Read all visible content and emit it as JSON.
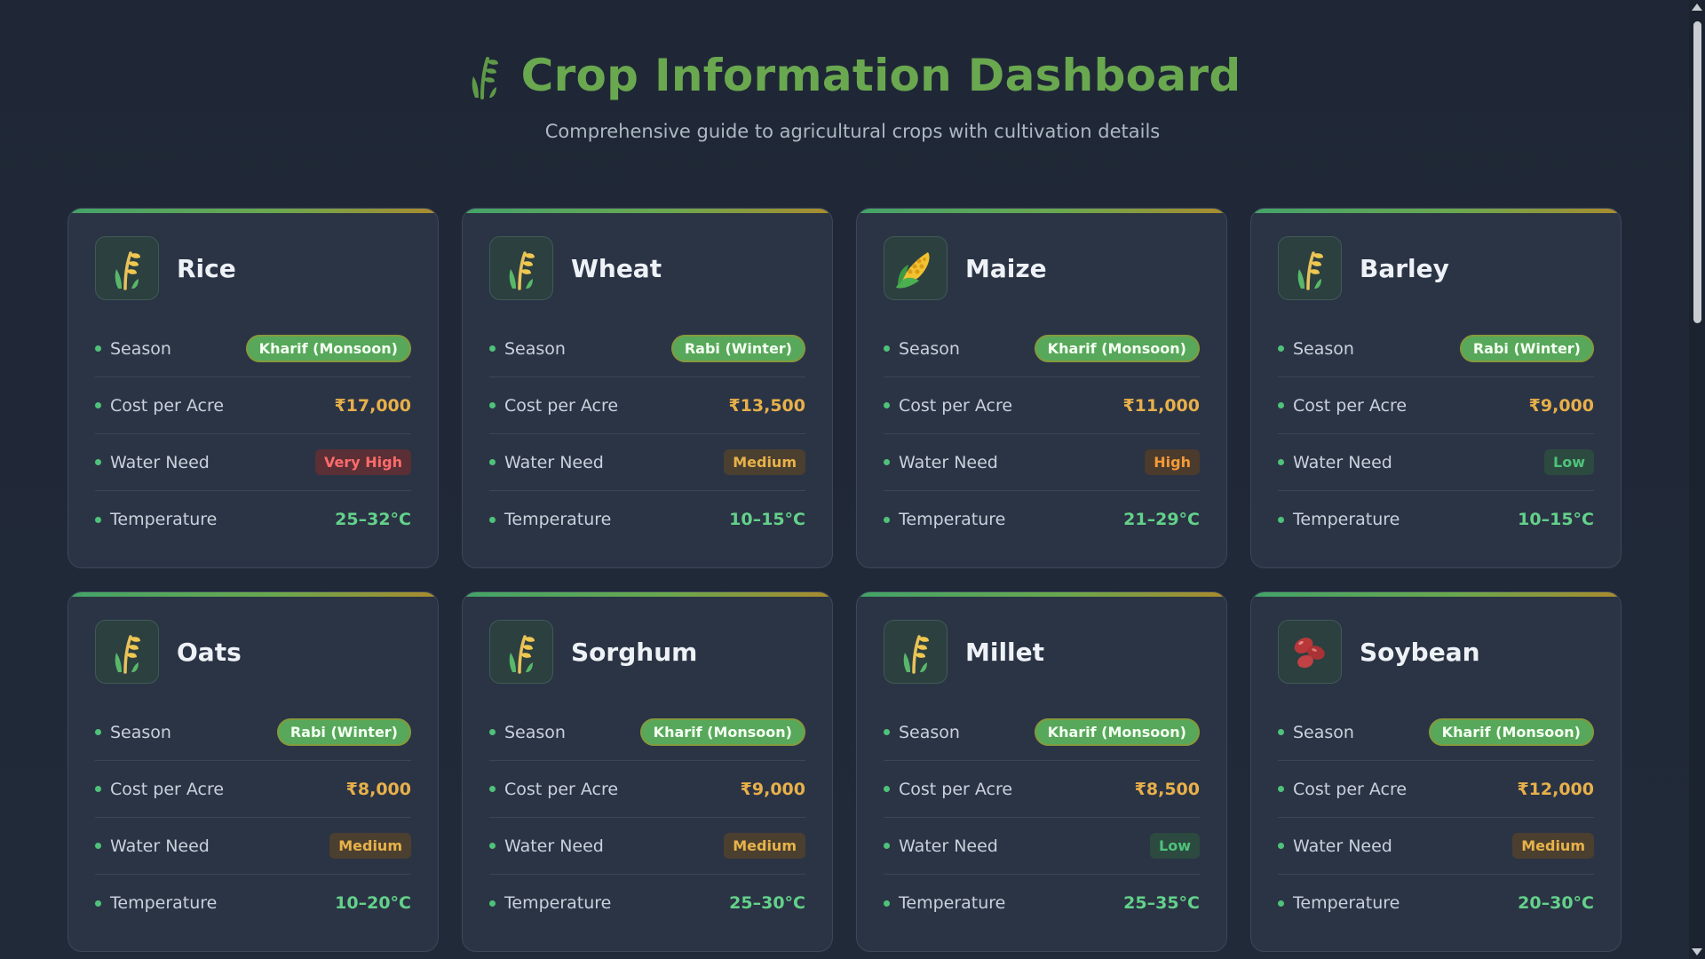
{
  "header": {
    "title": "Crop Information Dashboard",
    "subtitle": "Comprehensive guide to agricultural crops with cultivation details",
    "icon": "wheat-icon"
  },
  "labels": {
    "season": "Season",
    "cost": "Cost per Acre",
    "water": "Water Need",
    "temperature": "Temperature"
  },
  "crops": [
    {
      "name": "Rice",
      "icon": "wheat-icon",
      "season": "Kharif (Monsoon)",
      "cost": "₹17,000",
      "water": "Very High",
      "water_level": "veryhigh",
      "temperature": "25–32°C"
    },
    {
      "name": "Wheat",
      "icon": "wheat-icon",
      "season": "Rabi (Winter)",
      "cost": "₹13,500",
      "water": "Medium",
      "water_level": "medium",
      "temperature": "10–15°C"
    },
    {
      "name": "Maize",
      "icon": "corn-icon",
      "season": "Kharif (Monsoon)",
      "cost": "₹11,000",
      "water": "High",
      "water_level": "high",
      "temperature": "21–29°C"
    },
    {
      "name": "Barley",
      "icon": "wheat-icon",
      "season": "Rabi (Winter)",
      "cost": "₹9,000",
      "water": "Low",
      "water_level": "low",
      "temperature": "10–15°C"
    },
    {
      "name": "Oats",
      "icon": "wheat-icon",
      "season": "Rabi (Winter)",
      "cost": "₹8,000",
      "water": "Medium",
      "water_level": "medium",
      "temperature": "10–20°C"
    },
    {
      "name": "Sorghum",
      "icon": "wheat-icon",
      "season": "Kharif (Monsoon)",
      "cost": "₹9,000",
      "water": "Medium",
      "water_level": "medium",
      "temperature": "25–30°C"
    },
    {
      "name": "Millet",
      "icon": "wheat-icon",
      "season": "Kharif (Monsoon)",
      "cost": "₹8,500",
      "water": "Low",
      "water_level": "low",
      "temperature": "25–35°C"
    },
    {
      "name": "Soybean",
      "icon": "beans-icon",
      "season": "Kharif (Monsoon)",
      "cost": "₹12,000",
      "water": "Medium",
      "water_level": "medium",
      "temperature": "20–30°C"
    }
  ],
  "colors": {
    "accent": "#6aa84f",
    "cost": "#e8b04a",
    "temperature": "#63d18a",
    "season_pill": "#57a85a"
  }
}
